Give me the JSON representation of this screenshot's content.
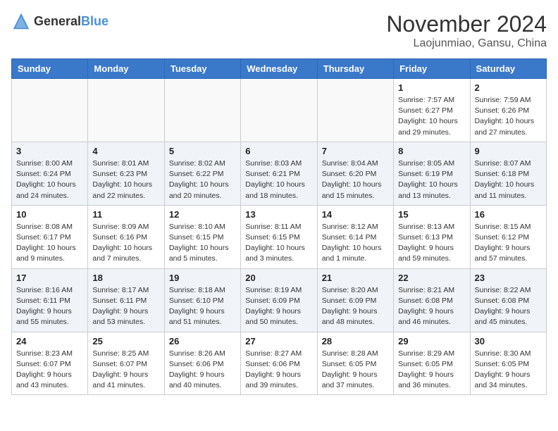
{
  "header": {
    "logo_general": "General",
    "logo_blue": "Blue",
    "month_year": "November 2024",
    "location": "Laojunmiao, Gansu, China"
  },
  "weekdays": [
    "Sunday",
    "Monday",
    "Tuesday",
    "Wednesday",
    "Thursday",
    "Friday",
    "Saturday"
  ],
  "weeks": [
    [
      {
        "day": "",
        "info": ""
      },
      {
        "day": "",
        "info": ""
      },
      {
        "day": "",
        "info": ""
      },
      {
        "day": "",
        "info": ""
      },
      {
        "day": "",
        "info": ""
      },
      {
        "day": "1",
        "info": "Sunrise: 7:57 AM\nSunset: 6:27 PM\nDaylight: 10 hours and 29 minutes."
      },
      {
        "day": "2",
        "info": "Sunrise: 7:59 AM\nSunset: 6:26 PM\nDaylight: 10 hours and 27 minutes."
      }
    ],
    [
      {
        "day": "3",
        "info": "Sunrise: 8:00 AM\nSunset: 6:24 PM\nDaylight: 10 hours and 24 minutes."
      },
      {
        "day": "4",
        "info": "Sunrise: 8:01 AM\nSunset: 6:23 PM\nDaylight: 10 hours and 22 minutes."
      },
      {
        "day": "5",
        "info": "Sunrise: 8:02 AM\nSunset: 6:22 PM\nDaylight: 10 hours and 20 minutes."
      },
      {
        "day": "6",
        "info": "Sunrise: 8:03 AM\nSunset: 6:21 PM\nDaylight: 10 hours and 18 minutes."
      },
      {
        "day": "7",
        "info": "Sunrise: 8:04 AM\nSunset: 6:20 PM\nDaylight: 10 hours and 15 minutes."
      },
      {
        "day": "8",
        "info": "Sunrise: 8:05 AM\nSunset: 6:19 PM\nDaylight: 10 hours and 13 minutes."
      },
      {
        "day": "9",
        "info": "Sunrise: 8:07 AM\nSunset: 6:18 PM\nDaylight: 10 hours and 11 minutes."
      }
    ],
    [
      {
        "day": "10",
        "info": "Sunrise: 8:08 AM\nSunset: 6:17 PM\nDaylight: 10 hours and 9 minutes."
      },
      {
        "day": "11",
        "info": "Sunrise: 8:09 AM\nSunset: 6:16 PM\nDaylight: 10 hours and 7 minutes."
      },
      {
        "day": "12",
        "info": "Sunrise: 8:10 AM\nSunset: 6:15 PM\nDaylight: 10 hours and 5 minutes."
      },
      {
        "day": "13",
        "info": "Sunrise: 8:11 AM\nSunset: 6:15 PM\nDaylight: 10 hours and 3 minutes."
      },
      {
        "day": "14",
        "info": "Sunrise: 8:12 AM\nSunset: 6:14 PM\nDaylight: 10 hours and 1 minute."
      },
      {
        "day": "15",
        "info": "Sunrise: 8:13 AM\nSunset: 6:13 PM\nDaylight: 9 hours and 59 minutes."
      },
      {
        "day": "16",
        "info": "Sunrise: 8:15 AM\nSunset: 6:12 PM\nDaylight: 9 hours and 57 minutes."
      }
    ],
    [
      {
        "day": "17",
        "info": "Sunrise: 8:16 AM\nSunset: 6:11 PM\nDaylight: 9 hours and 55 minutes."
      },
      {
        "day": "18",
        "info": "Sunrise: 8:17 AM\nSunset: 6:11 PM\nDaylight: 9 hours and 53 minutes."
      },
      {
        "day": "19",
        "info": "Sunrise: 8:18 AM\nSunset: 6:10 PM\nDaylight: 9 hours and 51 minutes."
      },
      {
        "day": "20",
        "info": "Sunrise: 8:19 AM\nSunset: 6:09 PM\nDaylight: 9 hours and 50 minutes."
      },
      {
        "day": "21",
        "info": "Sunrise: 8:20 AM\nSunset: 6:09 PM\nDaylight: 9 hours and 48 minutes."
      },
      {
        "day": "22",
        "info": "Sunrise: 8:21 AM\nSunset: 6:08 PM\nDaylight: 9 hours and 46 minutes."
      },
      {
        "day": "23",
        "info": "Sunrise: 8:22 AM\nSunset: 6:08 PM\nDaylight: 9 hours and 45 minutes."
      }
    ],
    [
      {
        "day": "24",
        "info": "Sunrise: 8:23 AM\nSunset: 6:07 PM\nDaylight: 9 hours and 43 minutes."
      },
      {
        "day": "25",
        "info": "Sunrise: 8:25 AM\nSunset: 6:07 PM\nDaylight: 9 hours and 41 minutes."
      },
      {
        "day": "26",
        "info": "Sunrise: 8:26 AM\nSunset: 6:06 PM\nDaylight: 9 hours and 40 minutes."
      },
      {
        "day": "27",
        "info": "Sunrise: 8:27 AM\nSunset: 6:06 PM\nDaylight: 9 hours and 39 minutes."
      },
      {
        "day": "28",
        "info": "Sunrise: 8:28 AM\nSunset: 6:05 PM\nDaylight: 9 hours and 37 minutes."
      },
      {
        "day": "29",
        "info": "Sunrise: 8:29 AM\nSunset: 6:05 PM\nDaylight: 9 hours and 36 minutes."
      },
      {
        "day": "30",
        "info": "Sunrise: 8:30 AM\nSunset: 6:05 PM\nDaylight: 9 hours and 34 minutes."
      }
    ]
  ]
}
